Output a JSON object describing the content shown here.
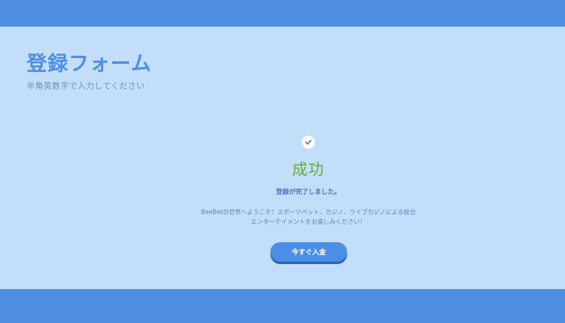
{
  "header": {
    "title": "登録フォーム",
    "subtitle": "半角英数字で入力してください"
  },
  "result": {
    "icon": "check-icon",
    "title": "成功",
    "lead": "登録が完了しました。",
    "message": "BeeBetの世界へようこそ！スポーツベット、カジノ、ライブカジノによる総合エンターテイメントをお楽しみください！"
  },
  "actions": {
    "deposit_label": "今すぐ入金"
  },
  "colors": {
    "brand": "#4f8fe3",
    "background": "#c3def9",
    "success": "#63a942",
    "button": "#4a8ee6"
  }
}
